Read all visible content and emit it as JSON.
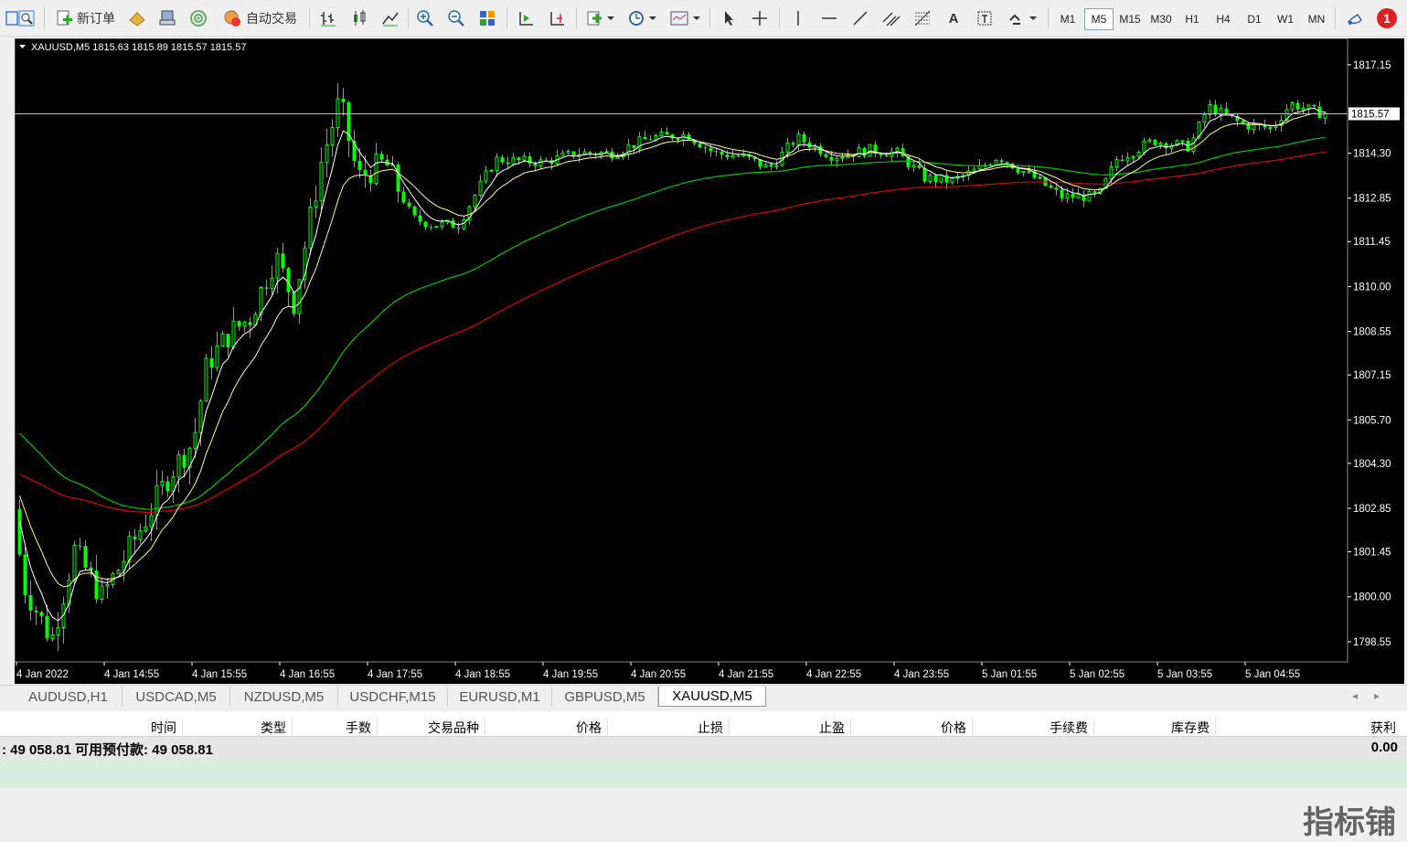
{
  "toolbar": {
    "new_order_label": "新订单",
    "autotrade_label": "自动交易",
    "timeframes": [
      "M1",
      "M5",
      "M15",
      "M30",
      "H1",
      "H4",
      "D1",
      "W1",
      "MN"
    ],
    "active_timeframe": "M5",
    "notification_count": "1"
  },
  "chart": {
    "info_line": "XAUUSD,M5  1815.63 1815.89 1815.57 1815.57",
    "current_price_label": "1815.57",
    "price_ticks": [
      "1817.15",
      "1815.57",
      "1814.30",
      "1812.85",
      "1811.45",
      "1810.00",
      "1808.55",
      "1807.15",
      "1805.70",
      "1804.30",
      "1802.85",
      "1801.45",
      "1800.00",
      "1798.55"
    ],
    "time_ticks": [
      "4 Jan 2022",
      "4 Jan 14:55",
      "4 Jan 15:55",
      "4 Jan 16:55",
      "4 Jan 17:55",
      "4 Jan 18:55",
      "4 Jan 19:55",
      "4 Jan 20:55",
      "4 Jan 21:55",
      "4 Jan 22:55",
      "4 Jan 23:55",
      "5 Jan 01:55",
      "5 Jan 02:55",
      "5 Jan 03:55",
      "5 Jan 04:55"
    ],
    "colors": {
      "background": "#000000",
      "bull": "#00ff00",
      "bear_body": "#00ff00",
      "ma_fast": "#ffffff",
      "ma_mid": "#ffff80",
      "ma_slow": "#00c800",
      "ma_long": "#e00000"
    }
  },
  "tabs": [
    "AUDUSD,H1",
    "USDCAD,M5",
    "NZDUSD,M5",
    "USDCHF,M15",
    "EURUSD,M1",
    "GBPUSD,M5",
    "XAUUSD,M5"
  ],
  "active_tab": "XAUUSD,M5",
  "terminal": {
    "columns": [
      "时间",
      "类型",
      "手数",
      "交易品种",
      "价格",
      "止损",
      "止盈",
      "价格",
      "手续费",
      "库存费",
      "获利"
    ],
    "balance_text": ": 49 058.81  可用预付款: 49 058.81",
    "profit_total": "0.00",
    "watermark": "指标铺"
  }
}
